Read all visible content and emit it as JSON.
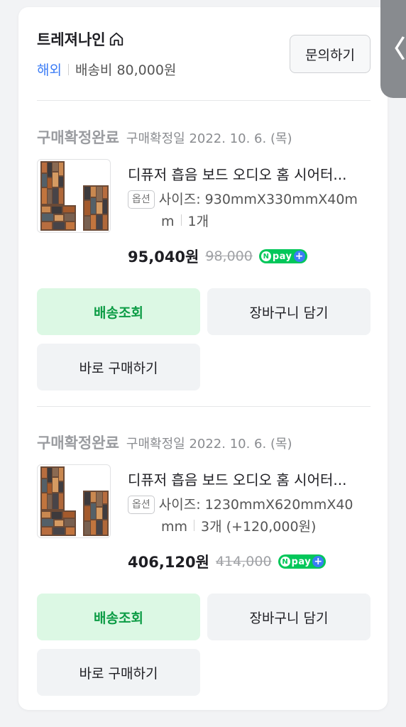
{
  "seller": {
    "name": "트레져나인",
    "region": "해외",
    "shipping": "배송비 80,000원",
    "inquiry_label": "문의하기"
  },
  "side_tab": {
    "label": "〈"
  },
  "orders": [
    {
      "status": "구매확정완료",
      "status_date": "구매확정일 2022. 10. 6. (목)",
      "product_title": "디퓨저 흡음 보드 오디오 홈 시어터...",
      "option_badge": "옵션",
      "option_line1": "사이즈: 930mmX330mmX40m",
      "option_line2_size": "m",
      "option_line2_qty": "1개",
      "price": "95,040원",
      "original_price": "98,000",
      "npay": "pay",
      "buttons": {
        "delivery": "배송조회",
        "cart": "장바구니 담기",
        "buy": "바로 구매하기"
      }
    },
    {
      "status": "구매확정완료",
      "status_date": "구매확정일 2022. 10. 6. (목)",
      "product_title": "디퓨저 흡음 보드 오디오 홈 시어터...",
      "option_badge": "옵션",
      "option_line1": "사이즈: 1230mmX620mmX40",
      "option_line2_size": "mm",
      "option_line2_qty": "3개 (+120,000원)",
      "price": "406,120원",
      "original_price": "414,000",
      "npay": "pay",
      "buttons": {
        "delivery": "배송조회",
        "cart": "장바구니 담기",
        "buy": "바로 구매하기"
      }
    }
  ],
  "colors": {
    "accent_green": "#0c9c45",
    "npay_green": "#03c75a",
    "link_blue": "#3b7cf5"
  },
  "icons": {
    "home": "home-icon",
    "npay_plus": "plus-icon"
  }
}
